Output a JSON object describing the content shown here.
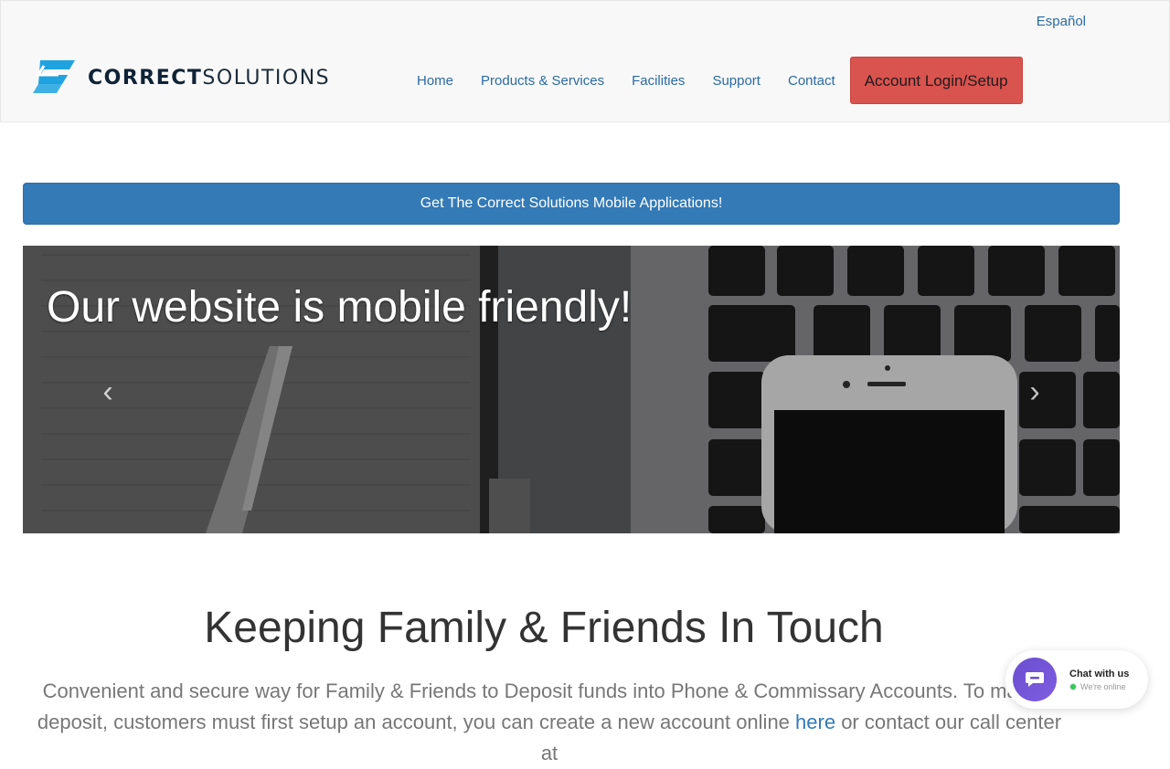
{
  "header": {
    "language_link": "Español",
    "logo_text_bold": "CORRECT",
    "logo_text_light": "SOLUTIONS",
    "nav": [
      {
        "label": "Home"
      },
      {
        "label": "Products & Services"
      },
      {
        "label": "Facilities"
      },
      {
        "label": "Support"
      },
      {
        "label": "Contact"
      }
    ],
    "login_button": "Account Login/Setup"
  },
  "banner": {
    "label": "Get The Correct Solutions Mobile Applications!"
  },
  "carousel": {
    "caption": "Our website is mobile friendly!",
    "prev_label": "‹",
    "next_label": "›"
  },
  "intro": {
    "title": "Keeping Family & Friends In Touch",
    "text_before_link": "Convenient and secure way for Family & Friends to Deposit funds into Phone & Commissary Accounts. To make a deposit, customers must first setup an account, you can create a new account online ",
    "link_text": "here",
    "text_after_link": " or contact our call center at"
  },
  "chat": {
    "title": "Chat with us",
    "status": "We're online"
  },
  "colors": {
    "nav_link": "#2a6aa5",
    "login_button": "#d9534f",
    "banner": "#337ab7",
    "chat_bubble": "#6b4fd0"
  }
}
